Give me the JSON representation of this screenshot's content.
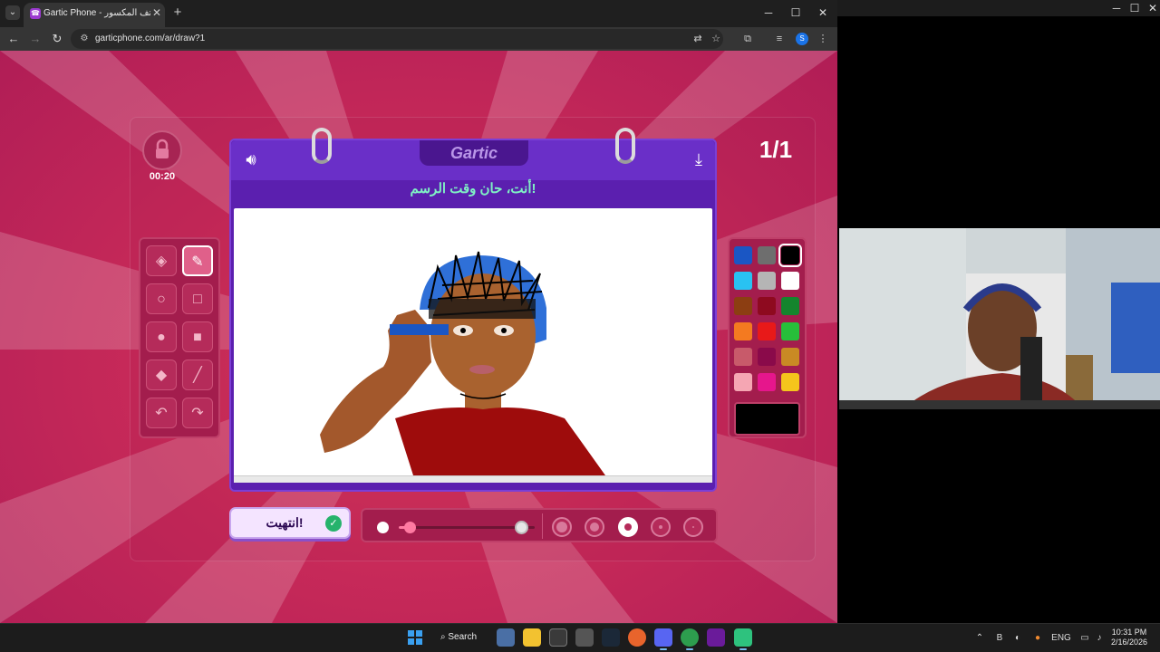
{
  "browser": {
    "tab_title": "Gartic Phone - الهاتف المكسور",
    "tab_close": "✕",
    "new_tab": "+",
    "url": "garticphone.com/ar/draw?1",
    "profile_initial": "S",
    "window_controls": {
      "minimize": "─",
      "maximize": "☐",
      "close": "✕"
    }
  },
  "game": {
    "timer": "00:20",
    "round": "1/1",
    "logo": "Gartic",
    "prompt": "أنت، حان وقت الرسم!",
    "done_button": "انتهيت!",
    "brush_size_fraction": 0.08,
    "tools": [
      {
        "name": "eraser-tool",
        "icon": "eraser-icon",
        "glyph": "◈",
        "active": false
      },
      {
        "name": "pencil-tool",
        "icon": "pencil-icon",
        "glyph": "✎",
        "active": true
      },
      {
        "name": "circle-outline-tool",
        "icon": "circle-outline-icon",
        "glyph": "○",
        "active": false
      },
      {
        "name": "rectangle-outline-tool",
        "icon": "rectangle-outline-icon",
        "glyph": "□",
        "active": false
      },
      {
        "name": "circle-fill-tool",
        "icon": "circle-fill-icon",
        "glyph": "●",
        "active": false
      },
      {
        "name": "rectangle-fill-tool",
        "icon": "rectangle-fill-icon",
        "glyph": "■",
        "active": false
      },
      {
        "name": "fill-bucket-tool",
        "icon": "fill-bucket-icon",
        "glyph": "◆",
        "active": false
      },
      {
        "name": "line-tool",
        "icon": "line-icon",
        "glyph": "╱",
        "active": false
      },
      {
        "name": "undo-tool",
        "icon": "undo-icon",
        "glyph": "↶",
        "active": false
      },
      {
        "name": "redo-tool",
        "icon": "redo-icon",
        "glyph": "↷",
        "active": false
      }
    ],
    "palette": [
      "#1a56c4",
      "#6e6e6e",
      "#000000",
      "#29c2f2",
      "#b5b5b5",
      "#ffffff",
      "#8c3e12",
      "#8e0a1f",
      "#14852d",
      "#f47a20",
      "#e81919",
      "#27bf3a",
      "#c85a6a",
      "#8a0a4a",
      "#c98a24",
      "#f5a6b3",
      "#e6168c",
      "#f5c51c"
    ],
    "selected_color": "#000000",
    "colors": {
      "accent": "#5b1faf",
      "prompt": "#7ff0c4",
      "background": "#c82a59"
    }
  },
  "taskbar": {
    "search_label": "Search",
    "language": "ENG",
    "time": "10:31 PM",
    "date": "2/16/2026",
    "apps": [
      "windows-start",
      "search",
      "file-explorer",
      "epic-games",
      "unity",
      "steam",
      "firefox",
      "discord",
      "chrome",
      "next",
      "gartic"
    ]
  }
}
